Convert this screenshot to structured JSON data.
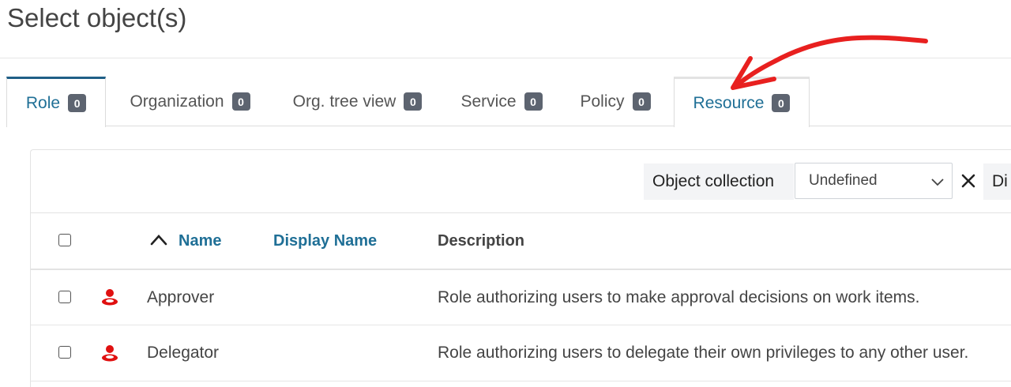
{
  "page": {
    "title": "Select object(s)"
  },
  "tabs": [
    {
      "label": "Role",
      "count": "0",
      "state": "active"
    },
    {
      "label": "Organization",
      "count": "0",
      "state": "normal"
    },
    {
      "label": "Org. tree view",
      "count": "0",
      "state": "normal"
    },
    {
      "label": "Service",
      "count": "0",
      "state": "normal"
    },
    {
      "label": "Policy",
      "count": "0",
      "state": "normal"
    },
    {
      "label": "Resource",
      "count": "0",
      "state": "highlighted"
    }
  ],
  "toolbar": {
    "collection_label": "Object collection",
    "collection_value": "Undefined",
    "clear_icon": "close-icon",
    "next_button_label": "Di"
  },
  "table": {
    "columns": [
      {
        "label": "Name",
        "sortable": true,
        "sort": "ascending"
      },
      {
        "label": "Display Name",
        "sortable": true
      },
      {
        "label": "Description",
        "sortable": false
      }
    ],
    "rows": [
      {
        "icon": "role-icon",
        "name": "Approver",
        "display_name": "",
        "description": "Role authorizing users to make approval decisions on work items."
      },
      {
        "icon": "role-icon",
        "name": "Delegator",
        "display_name": "",
        "description": "Role authorizing users to delegate their own privileges to any other user."
      }
    ]
  },
  "colors": {
    "accent": "#1f6f96",
    "active_tab_border": "#1f5f87",
    "badge": "#5d6470",
    "role_icon": "#e01010",
    "annotation_arrow": "#e8201f"
  }
}
